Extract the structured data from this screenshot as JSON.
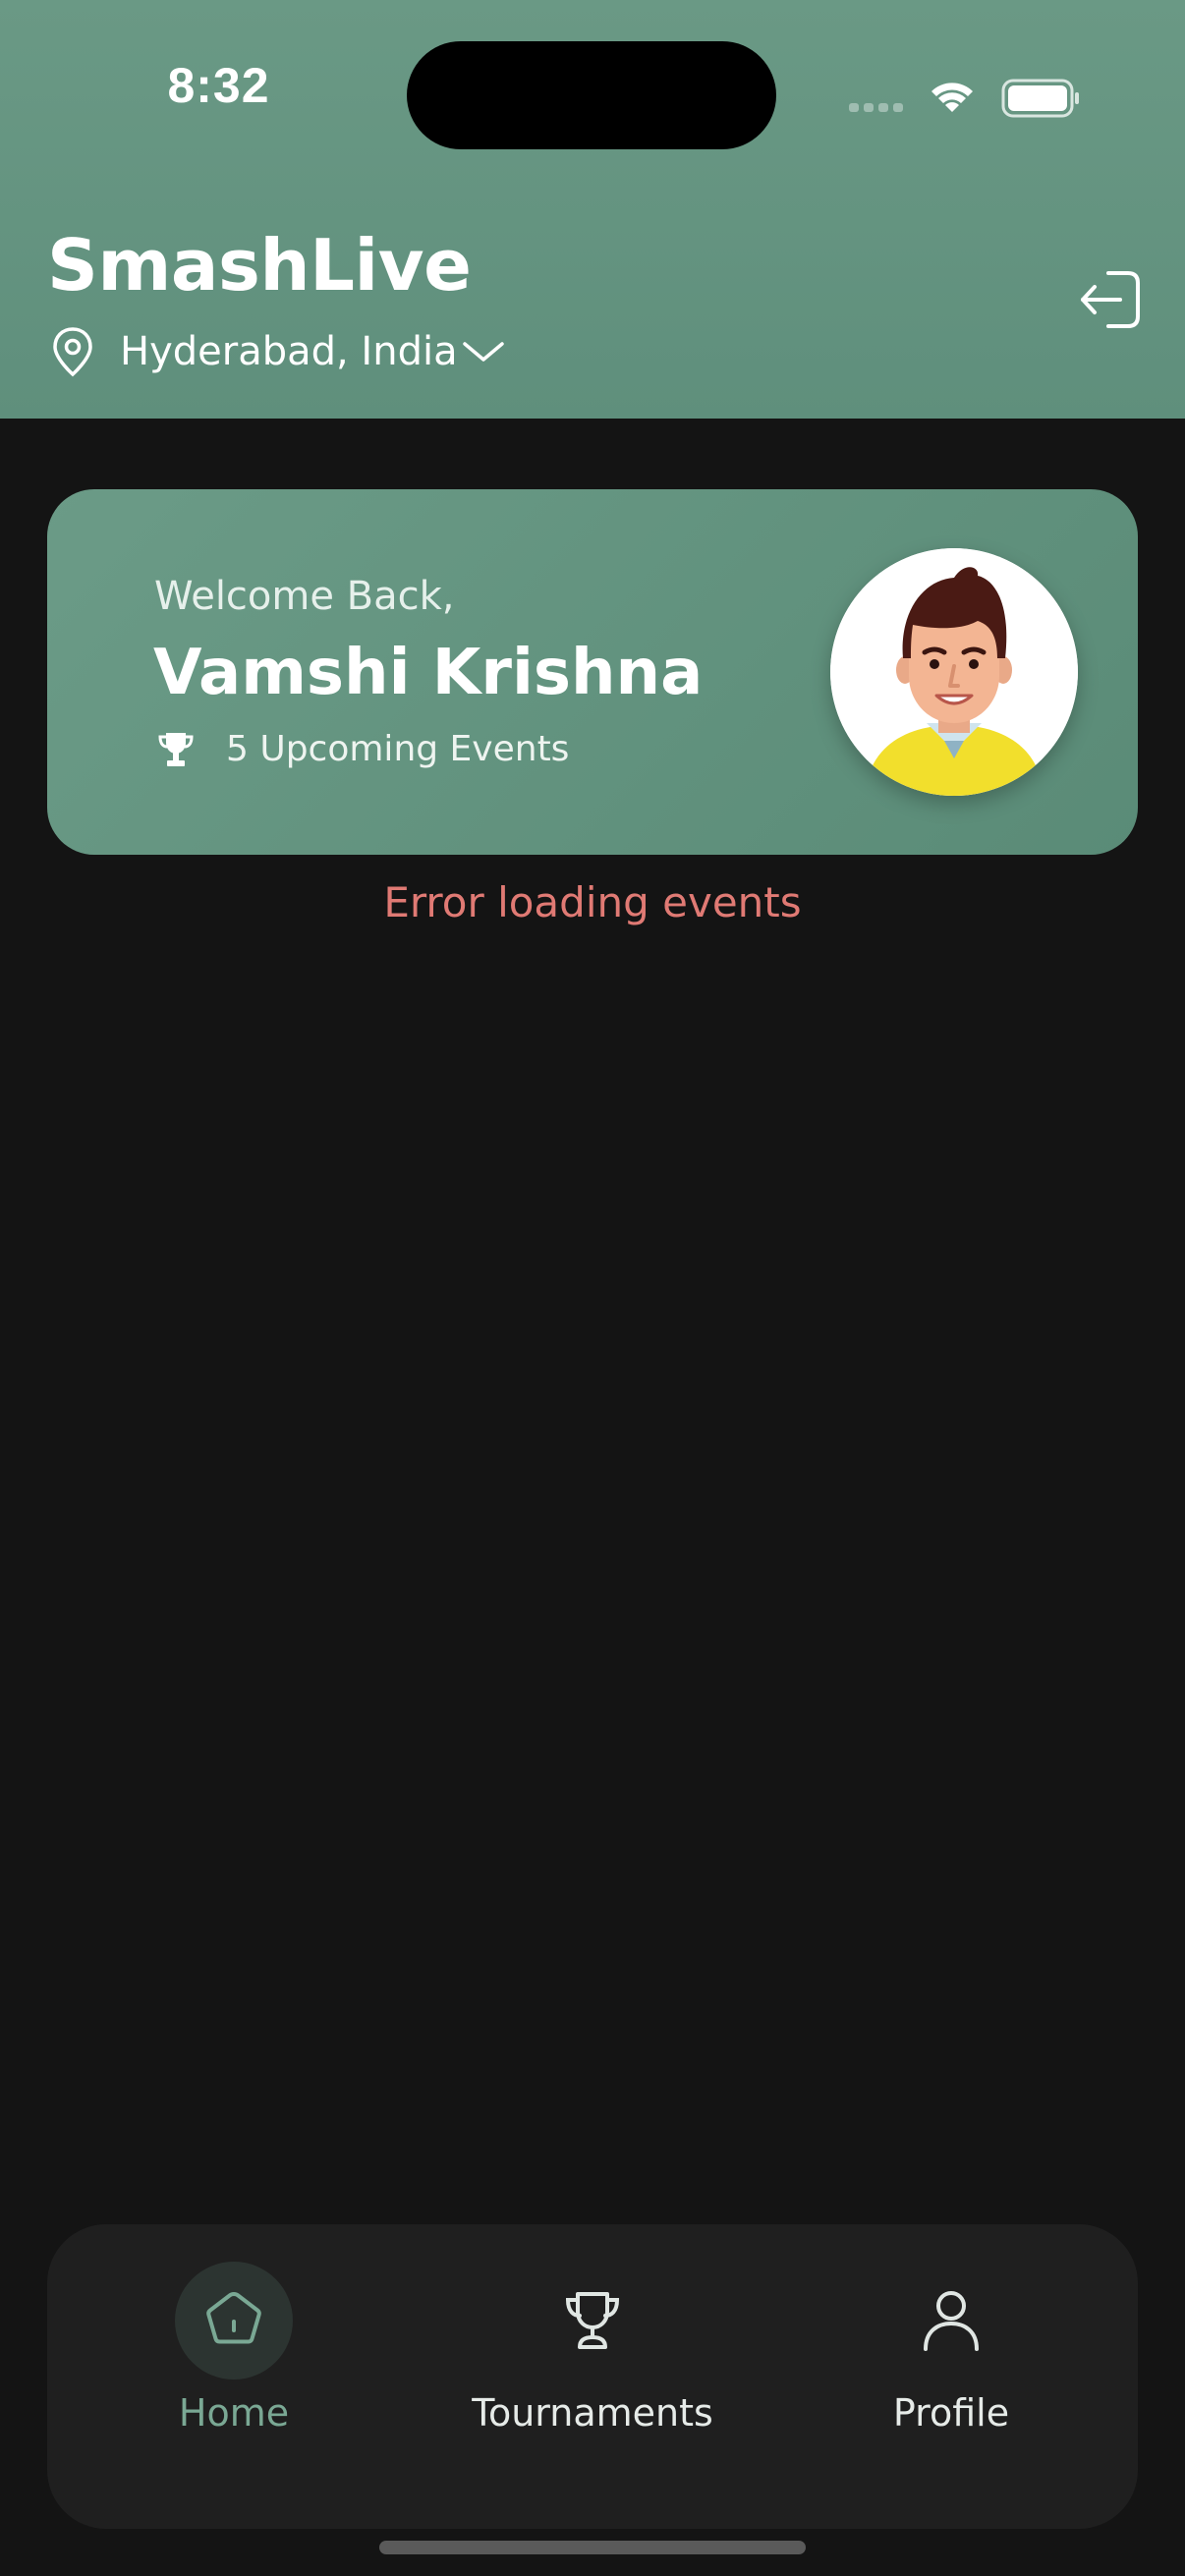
{
  "status_bar": {
    "time": "8:32"
  },
  "header": {
    "title": "SmashLive",
    "location": "Hyderabad, India"
  },
  "welcome": {
    "greeting": "Welcome Back,",
    "name": "Vamshi Krishna",
    "upcoming": "5 Upcoming Events"
  },
  "error": {
    "message": "Error loading events"
  },
  "nav": {
    "items": [
      {
        "label": "Home",
        "icon": "home-icon",
        "active": true
      },
      {
        "label": "Tournaments",
        "icon": "trophy-icon",
        "active": false
      },
      {
        "label": "Profile",
        "icon": "person-icon",
        "active": false
      }
    ]
  },
  "colors": {
    "accent": "#6a9985",
    "background": "#141414",
    "error": "#e07a74",
    "nav_active": "#7aa894"
  }
}
